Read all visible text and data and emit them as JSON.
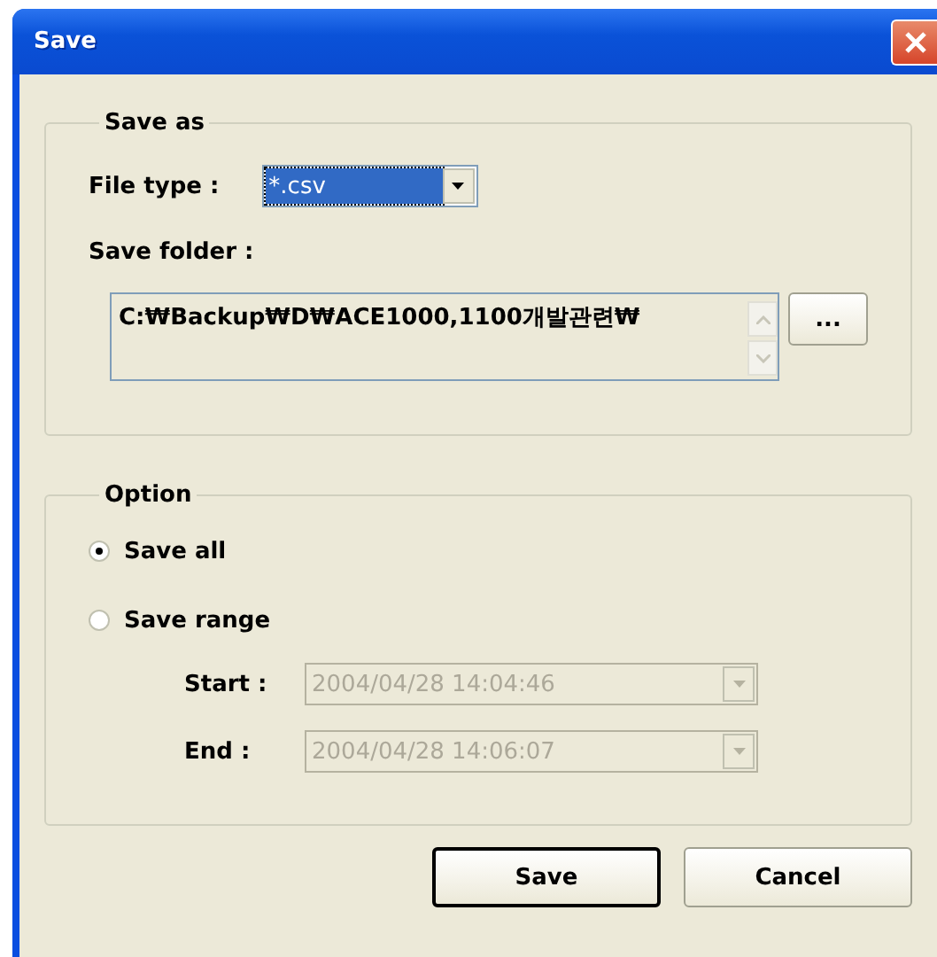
{
  "window": {
    "title": "Save"
  },
  "save_as": {
    "title": "Save as",
    "file_type": {
      "label": "File type :",
      "value": "*.csv",
      "focused": true
    },
    "save_folder": {
      "label": "Save folder :",
      "value": "C:₩Backup₩D₩ACE1000,1100개발관련₩"
    },
    "browse_button": "..."
  },
  "option": {
    "title": "Option",
    "radios": [
      {
        "label": "Save all",
        "selected": true
      },
      {
        "label": "Save range",
        "selected": false
      }
    ],
    "range": [
      {
        "label": "Start :",
        "value": "2004/04/28 14:04:46",
        "disabled": true
      },
      {
        "label": "End :",
        "value": "2004/04/28 14:06:07",
        "disabled": true
      }
    ]
  },
  "buttons": [
    {
      "label": "Save",
      "default": true
    },
    {
      "label": "Cancel",
      "default": false
    }
  ]
}
